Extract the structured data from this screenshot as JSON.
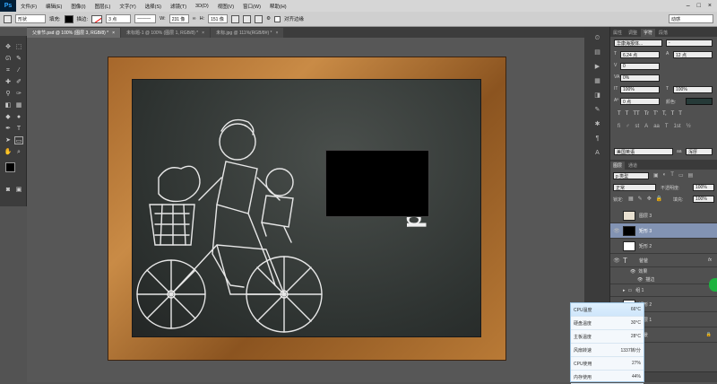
{
  "menubar": {
    "app_logo": "Ps",
    "items": [
      "文件(F)",
      "编辑(E)",
      "图像(I)",
      "图层(L)",
      "文字(Y)",
      "选择(S)",
      "滤镜(T)",
      "3D(D)",
      "视图(V)",
      "窗口(W)",
      "帮助(H)"
    ]
  },
  "options": {
    "mode": "形状",
    "fill_label": "填充:",
    "stroke_label": "描边:",
    "stroke_size": "3 点",
    "w_label": "W:",
    "w_value": "231 像",
    "h_label": "H:",
    "h_value": "151 像",
    "align_edges": "对齐边缘",
    "workspace": "动感"
  },
  "tabs": [
    "父亲节.psd @ 100% (图层 3, RGB/8) *",
    "未标题-1 @ 100% (图层 1, RGB/8) *",
    "未标.jpg @ 111%(RGB/8#) *"
  ],
  "character_panel": {
    "tabs": [
      "属性",
      "调整",
      "字符",
      "段落"
    ],
    "font_family": "华康海报体...",
    "font_style": "-",
    "font_size": "6.24 点",
    "leading": "12 点",
    "kerning": "0",
    "tracking": "0%",
    "vscale": "100%",
    "hscale": "100%",
    "baseline": "0 点",
    "color_label": "颜色:",
    "language": "美国英语",
    "antialias": "浑厚",
    "style_buttons": [
      "T",
      "T",
      "TT",
      "Tr",
      "T'",
      "T,",
      "T",
      "T"
    ]
  },
  "layers_panel": {
    "tabs": [
      "图层",
      "通道"
    ],
    "filter_label": "p 类型",
    "blend_mode": "正常",
    "opacity_label": "不透明度:",
    "opacity": "100%",
    "lock_label": "锁定:",
    "fill_label": "填充:",
    "fill": "100%",
    "layers": [
      {
        "name": "图层 3"
      },
      {
        "name": "矩形 3"
      },
      {
        "name": "矩形 2"
      },
      {
        "name": "爸爸",
        "fx": "fx"
      },
      {
        "name": "效果"
      },
      {
        "name": "描边"
      },
      {
        "name": "组 1"
      },
      {
        "name": "矩形 2"
      },
      {
        "name": "图层 1"
      },
      {
        "name": "背景"
      }
    ]
  },
  "cpu_widget": {
    "rows": [
      {
        "label": "CPU温度",
        "value": "66°C"
      },
      {
        "label": "硬盘温度",
        "value": "30°C"
      },
      {
        "label": "主板温度",
        "value": "28°C"
      },
      {
        "label": "风扇转速",
        "value": "1337转/分"
      },
      {
        "label": "CPU使用",
        "value": "27%"
      },
      {
        "label": "内存使用",
        "value": "44%"
      }
    ]
  },
  "canvas": {
    "chalk_text": "Dad"
  }
}
